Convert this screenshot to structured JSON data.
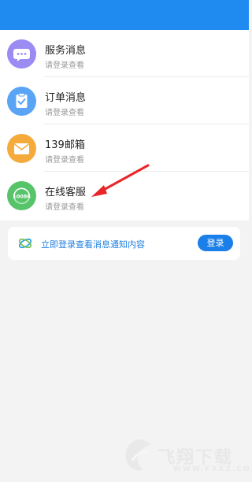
{
  "messages": [
    {
      "title": "服务消息",
      "subtitle": "请登录查看",
      "icon": "chat-bubble-icon",
      "color": "#9a8cf2"
    },
    {
      "title": "订单消息",
      "subtitle": "请登录查看",
      "icon": "clipboard-check-icon",
      "color": "#5aa4f6"
    },
    {
      "title": "139邮箱",
      "subtitle": "请登录查看",
      "icon": "mail-envelope-icon",
      "color": "#f4ab3b"
    },
    {
      "title": "在线客服",
      "subtitle": "请登录查看",
      "icon": "customer-service-10086-icon",
      "color": "#58c46a",
      "icon_text": "10086"
    }
  ],
  "banner": {
    "text": "立即登录查看消息通知内容",
    "login_label": "登录",
    "logo": "china-mobile-logo"
  },
  "watermark": {
    "text": "飞翔下载",
    "url": "WWW.FXXZ.COM"
  },
  "annotation": {
    "type": "red-arrow",
    "target": "在线客服",
    "color": "#e8262a"
  },
  "colors": {
    "header": "#1f8bf0",
    "accent": "#1a7fe8",
    "background": "#f3f3f3"
  }
}
